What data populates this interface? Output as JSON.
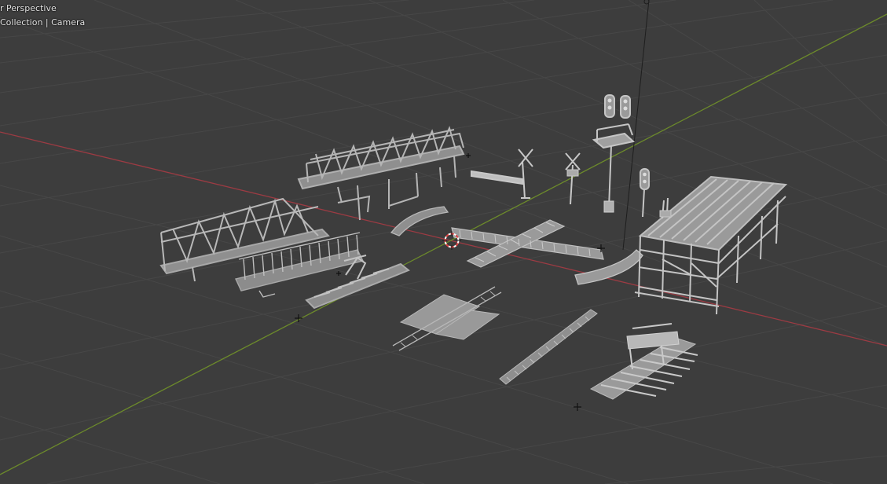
{
  "viewport": {
    "view_name": "r Perspective",
    "collection_line": "Collection | Camera"
  },
  "colors": {
    "background": "#3d3d3d",
    "grid": "#474747",
    "x_axis": "#9c3b43",
    "y_axis": "#6c8a2b",
    "object": "#a6a6a6",
    "object_dark": "#7a7a7a",
    "object_light": "#c9c9c9",
    "cursor_red": "#e04040",
    "cursor_white": "#ffffff"
  },
  "objects": [
    "truss-bridge-deck",
    "truss-bridge-left",
    "railing-section",
    "buffer-stop-small",
    "curved-rail-top",
    "crossing-gate-arm",
    "crossing-sign-left",
    "crossing-sign-right",
    "signal-mast-tall",
    "signal-mast-small",
    "rail-crossing-x",
    "curved-rail-right",
    "trestle-bridge-right",
    "level-crossing-pads",
    "straight-rail-section",
    "buffer-stop-large",
    "camera-wire"
  ]
}
